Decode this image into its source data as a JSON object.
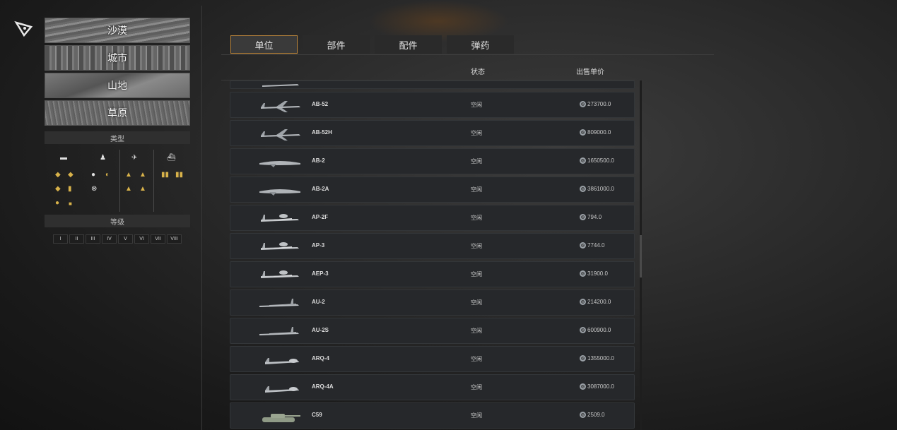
{
  "terrains": {
    "desert": "沙漠",
    "city": "城市",
    "mountain": "山地",
    "grassland": "草原"
  },
  "filters": {
    "type_label": "类型",
    "level_label": "等级",
    "levels": [
      "I",
      "II",
      "III",
      "IV",
      "V",
      "VI",
      "VII",
      "VIII"
    ]
  },
  "tabs": {
    "units": "单位",
    "parts": "部件",
    "accessories": "配件",
    "ammo": "弹药"
  },
  "table": {
    "status_header": "状态",
    "price_header": "出售单价",
    "rows": [
      {
        "name": "AB-52",
        "status": "空闲",
        "price": "273700.0",
        "kind": "bomber"
      },
      {
        "name": "AB-52H",
        "status": "空闲",
        "price": "809000.0",
        "kind": "bomber"
      },
      {
        "name": "AB-2",
        "status": "空闲",
        "price": "1650500.0",
        "kind": "flying-wing"
      },
      {
        "name": "AB-2A",
        "status": "空闲",
        "price": "3861000.0",
        "kind": "flying-wing"
      },
      {
        "name": "AP-2F",
        "status": "空闲",
        "price": "794.0",
        "kind": "prop-plane"
      },
      {
        "name": "AP-3",
        "status": "空闲",
        "price": "7744.0",
        "kind": "prop-plane"
      },
      {
        "name": "AEP-3",
        "status": "空闲",
        "price": "31900.0",
        "kind": "prop-plane"
      },
      {
        "name": "AU-2",
        "status": "空闲",
        "price": "214200.0",
        "kind": "recon-jet"
      },
      {
        "name": "AU-2S",
        "status": "空闲",
        "price": "600900.0",
        "kind": "recon-jet"
      },
      {
        "name": "ARQ-4",
        "status": "空闲",
        "price": "1355000.0",
        "kind": "drone"
      },
      {
        "name": "ARQ-4A",
        "status": "空闲",
        "price": "3087000.0",
        "kind": "drone"
      },
      {
        "name": "C59",
        "status": "空闲",
        "price": "2509.0",
        "kind": "tank"
      }
    ]
  },
  "icons": {
    "logo": "pen-nib-logo-icon",
    "coin": "coin-icon",
    "accent_color": "#b8833a",
    "rank_color": "#d8b24a"
  }
}
